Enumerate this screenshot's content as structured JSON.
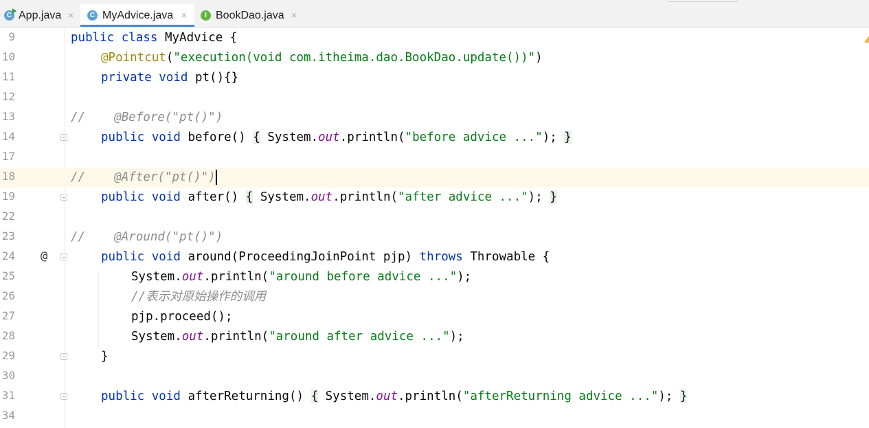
{
  "tabs": [
    {
      "label": "App.java",
      "icon": "class-app-icon",
      "active": false
    },
    {
      "label": "MyAdvice.java",
      "icon": "class-icon",
      "active": true
    },
    {
      "label": "BookDao.java",
      "icon": "interface-icon",
      "active": false
    }
  ],
  "tab_icons": {
    "class": "C",
    "interface": "I"
  },
  "close_glyph": "×",
  "gutter_markers": {
    "override_icon": "@"
  },
  "lines": [
    {
      "num": "9"
    },
    {
      "num": "10"
    },
    {
      "num": "11"
    },
    {
      "num": "12"
    },
    {
      "num": "13"
    },
    {
      "num": "14"
    },
    {
      "num": "17"
    },
    {
      "num": "18"
    },
    {
      "num": "19"
    },
    {
      "num": "22"
    },
    {
      "num": "23"
    },
    {
      "num": "24"
    },
    {
      "num": "25"
    },
    {
      "num": "26"
    },
    {
      "num": "27"
    },
    {
      "num": "28"
    },
    {
      "num": "29"
    },
    {
      "num": "30"
    },
    {
      "num": "31"
    },
    {
      "num": "34"
    }
  ],
  "code": {
    "l9": {
      "kw1": "public class",
      "rest": " MyAdvice {"
    },
    "l10": {
      "ann": "@Pointcut",
      "p1": "(",
      "str": "\"execution(void com.itheima.dao.BookDao.update())\"",
      "p2": ")"
    },
    "l11": {
      "kw": "private void",
      "rest": " pt(){}"
    },
    "l13": {
      "cm": "//    @Before(\"pt()\")"
    },
    "l14": {
      "kw": "public void",
      "name": " before() ",
      "ob": "{",
      "sys": " System.",
      "out": "out",
      "pr": ".println(",
      "str": "\"before advice ...\"",
      "end": "); ",
      "cb": "}"
    },
    "l18": {
      "cm": "//    @After(\"pt()\")"
    },
    "l19": {
      "kw": "public void",
      "name": " after() ",
      "ob": "{",
      "sys": " System.",
      "out": "out",
      "pr": ".println(",
      "str": "\"after advice ...\"",
      "end": "); ",
      "cb": "}"
    },
    "l23": {
      "cm": "//    @Around(\"pt()\")"
    },
    "l24": {
      "kw": "public void",
      "name": " around(ProceedingJoinPoint pjp) ",
      "kw2": "throws",
      "rest": " Throwable {"
    },
    "l25": {
      "sys": "System.",
      "out": "out",
      "pr": ".println(",
      "str": "\"around before advice ...\"",
      "end": ");"
    },
    "l26": {
      "cm": "//表示对原始操作的调用"
    },
    "l27": {
      "text": "pjp.proceed();"
    },
    "l28": {
      "sys": "System.",
      "out": "out",
      "pr": ".println(",
      "str": "\"around after advice ...\"",
      "end": ");"
    },
    "l29": {
      "text": "}"
    },
    "l31": {
      "kw": "public void",
      "name": " afterReturning() ",
      "ob": "{",
      "sys": " System.",
      "out": "out",
      "pr": ".println(",
      "str": "\"afterReturning advice ...\"",
      "end": "); ",
      "cb": "}"
    }
  },
  "colors": {
    "keyword": "#0033b3",
    "annotation": "#9e880d",
    "string": "#067d17",
    "comment": "#8c8c8c",
    "field": "#871094",
    "tab_underline": "#4a88c7"
  }
}
